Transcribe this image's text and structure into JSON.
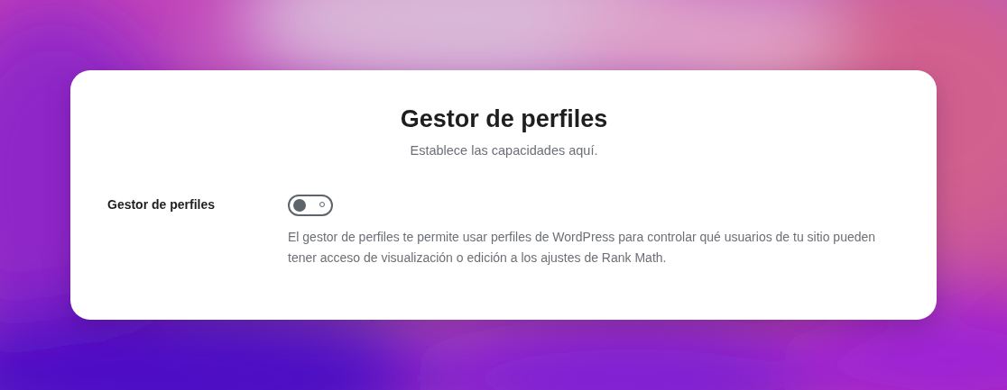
{
  "card": {
    "title": "Gestor de perfiles",
    "subtitle": "Establece las capacidades aquí.",
    "setting": {
      "label": "Gestor de perfiles",
      "on": false,
      "description": "El gestor de perfiles te permite usar perfiles de WordPress para controlar qué usuarios de tu sitio pueden tener acceso de visualización o edición a los ajustes de Rank Math."
    }
  }
}
